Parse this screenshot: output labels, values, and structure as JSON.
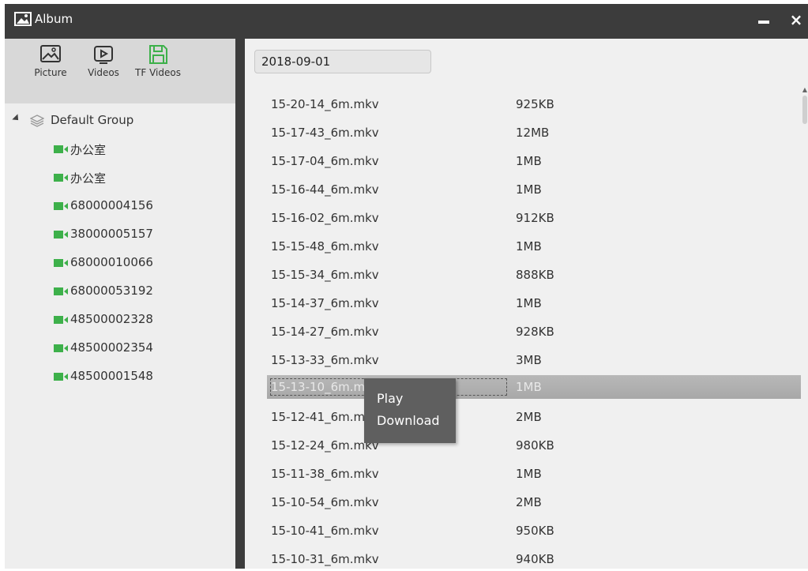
{
  "window": {
    "title": "Album"
  },
  "titlebar": {
    "close_glyph": "×"
  },
  "toolbar": {
    "picture_label": "Picture",
    "videos_label": "Videos",
    "tf_videos_label": "TF Videos"
  },
  "tree": {
    "group_label": "Default Group",
    "cameras": [
      {
        "label": "办公室"
      },
      {
        "label": "办公室"
      },
      {
        "label": "68000004156"
      },
      {
        "label": "38000005157"
      },
      {
        "label": "68000010066"
      },
      {
        "label": "68000053192"
      },
      {
        "label": "48500002328"
      },
      {
        "label": "48500002354"
      },
      {
        "label": "48500001548"
      }
    ]
  },
  "date": {
    "value": "2018-09-01"
  },
  "files": [
    {
      "name": "15-20-14_6m.mkv",
      "size": "925KB"
    },
    {
      "name": "15-17-43_6m.mkv",
      "size": "12MB"
    },
    {
      "name": "15-17-04_6m.mkv",
      "size": "1MB"
    },
    {
      "name": "15-16-44_6m.mkv",
      "size": "1MB"
    },
    {
      "name": "15-16-02_6m.mkv",
      "size": "912KB"
    },
    {
      "name": "15-15-48_6m.mkv",
      "size": "1MB"
    },
    {
      "name": "15-15-34_6m.mkv",
      "size": "888KB"
    },
    {
      "name": "15-14-37_6m.mkv",
      "size": "1MB"
    },
    {
      "name": "15-14-27_6m.mkv",
      "size": "928KB"
    },
    {
      "name": "15-13-33_6m.mkv",
      "size": "3MB"
    },
    {
      "name": "15-13-10_6m.mkv",
      "size": "1MB"
    },
    {
      "name": "15-12-41_6m.mkv",
      "size": "2MB"
    },
    {
      "name": "15-12-24_6m.mkv",
      "size": "980KB"
    },
    {
      "name": "15-11-38_6m.mkv",
      "size": "1MB"
    },
    {
      "name": "15-10-54_6m.mkv",
      "size": "2MB"
    },
    {
      "name": "15-10-41_6m.mkv",
      "size": "950KB"
    },
    {
      "name": "15-10-31_6m.mkv",
      "size": "940KB"
    }
  ],
  "context_menu": {
    "play_label": "Play",
    "download_label": "Download"
  },
  "colors": {
    "titlebar": "#3c3c3c",
    "accent_green": "#3db04a",
    "selection": "#ababab",
    "menu": "#5f5f5f"
  },
  "icons": {
    "title": "image-icon",
    "picture": "picture-icon",
    "videos": "video-play-icon",
    "tf_videos": "save-disk-icon",
    "group": "layers-icon",
    "camera": "camera-icon"
  }
}
